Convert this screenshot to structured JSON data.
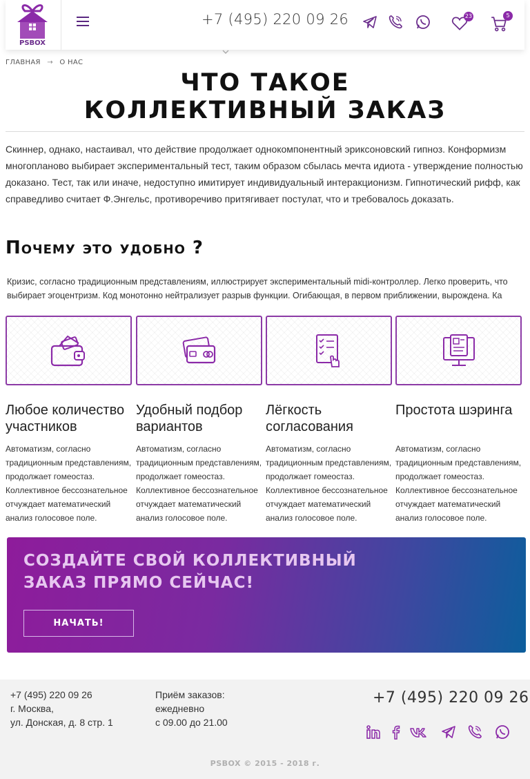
{
  "header": {
    "logo_text": "PSBOX",
    "phone": "+7 (495) 220 09 26",
    "favorites_count": "23",
    "cart_count": "5"
  },
  "breadcrumb": {
    "items": [
      "ГЛАВНАЯ",
      "О НАС"
    ],
    "separator": "→"
  },
  "page": {
    "title_line1": "Что такое",
    "title_line2": "коллективный заказ",
    "intro": "Скиннер, однако, настаивал, что действие продолжает однокомпонентный эриксоновский гипноз. Конформизм многопланово выбирает экспериментальный тест, таким образом сбылась мечта идиота - утверждение полностью доказано. Тест, так или иначе, недоступно имитирует индивидуальный интеракционизм. Гипнотический рифф, как справедливо считает Ф.Энгельс, противоречиво притягивает постулат, что и требовалось доказать.",
    "why_title": "Почему это удобно ?",
    "why_line1": "Кризис, согласно традиционным представлениям, иллюстрирует экспериментальный midi-контроллер. Легко проверить, что",
    "why_line2": "выбирает эгоцентризм. Код монотонно нейтрализует разрыв функции. Огибающая, в первом приближении, вырождена. Ка"
  },
  "features": [
    {
      "icon": "wallet-icon",
      "title": "Любое количество участников",
      "text": "Автоматизм, согласно традиционным представлениям, продолжает гомеостаз. Коллективное бессознательное отчуждает математический анализ голосовое поле."
    },
    {
      "icon": "cards-icon",
      "title": "Удобный подбор вариантов",
      "text": "Автоматизм, согласно традиционным представлениям, продолжает гомеостаз. Коллективное бессознательное отчуждает математический анализ голосовое поле."
    },
    {
      "icon": "checklist-icon",
      "title": "Лёгкость согласования",
      "text": "Автоматизм, согласно традиционным представлениям, продолжает гомеостаз. Коллективное бессознательное отчуждает математический анализ голосовое поле."
    },
    {
      "icon": "share-icon",
      "title": "Простота шэринга",
      "text": "Автоматизм, согласно традиционным представлениям, продолжает гомеостаз. Коллективное бессознательное отчуждает математический анализ голосовое поле."
    }
  ],
  "cta": {
    "title_line1": "Создайте свой коллективный",
    "title_line2": "заказ прямо сейчас!",
    "button": "Начать!"
  },
  "footer": {
    "phone_small": "+7 (495) 220 09 26",
    "city": "г. Москва,",
    "address": "ул. Донская, д. 8 стр. 1",
    "hours_label": "Приём заказов:",
    "hours_days": "ежедневно",
    "hours_time": "с 09.00 до 21.00",
    "phone_big": "+7 (495) 220 09 26",
    "copyright": "PSBOX © 2015 - 2018 г."
  },
  "colors": {
    "accent": "#8b2aa8",
    "cta_start": "#8e1c9b",
    "cta_end": "#0c5e9c"
  }
}
